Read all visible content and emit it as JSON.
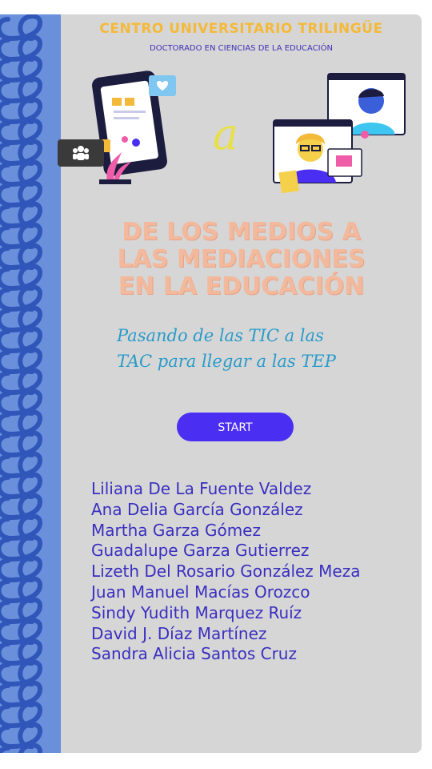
{
  "header": {
    "institution": "CENTRO UNIVERSITARIO TRILINGÜE",
    "program": "DOCTORADO EN CIENCIAS DE LA EDUCACIÓN"
  },
  "illustration": {
    "connector": "a"
  },
  "title": {
    "line1": "DE LOS MEDIOS A",
    "line2": "LAS MEDIACIONES",
    "line3": "EN LA EDUCACIÓN"
  },
  "subtitle": {
    "line1": "Pasando de las TIC a las",
    "line2": "TAC para llegar a las TEP"
  },
  "start_button": {
    "label": "START"
  },
  "authors": [
    "Liliana De La Fuente Valdez",
    "Ana Delia García González",
    "Martha Garza Gómez",
    "Guadalupe Garza Gutierrez",
    "Lizeth Del Rosario González Meza",
    "Juan Manuel Macías Orozco",
    "Sindy Yudith Marquez Ruíz",
    "David J. Díaz Martínez",
    "Sandra Alicia Santos Cruz"
  ],
  "colors": {
    "background": "#d6d6d6",
    "spine": "#6a8fdb",
    "spiral": "#2f56b8",
    "header_accent": "#f5b93a",
    "title": "#f2b99d",
    "subtitle": "#2a9bc9",
    "button": "#4a2ef2",
    "authors": "#3a2fc0"
  },
  "icons": [
    "spiral-binding-icon",
    "tablet-illustration-icon",
    "video-call-illustration-icon",
    "people-icon"
  ]
}
